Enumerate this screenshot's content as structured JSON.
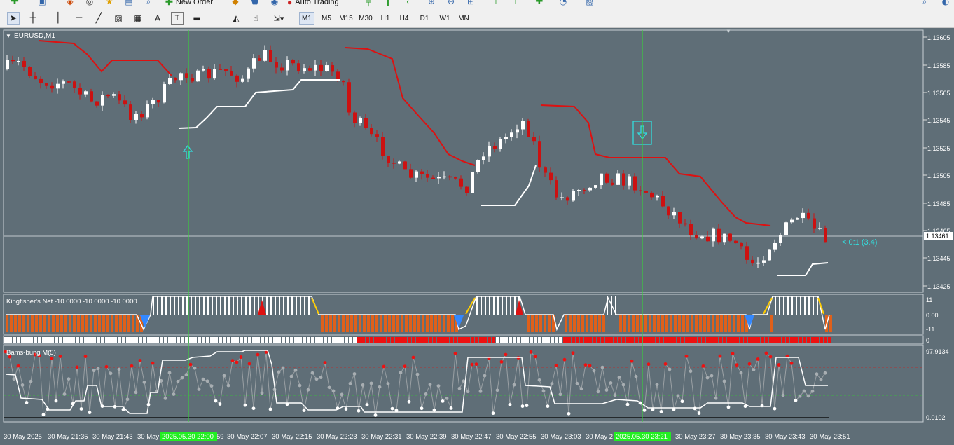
{
  "toolbar_top": {
    "new_order_label": "New Order",
    "auto_trading_label": "Auto Trading"
  },
  "toolbar_tools": {
    "timeframes": [
      "M1",
      "M5",
      "M15",
      "M30",
      "H1",
      "H4",
      "D1",
      "W1",
      "MN"
    ],
    "active_timeframe": "M1"
  },
  "chart": {
    "symbol_label": "EURUSD,M1",
    "price_labels": [
      "1.13605",
      "1.13585",
      "1.13565",
      "1.13545",
      "1.13525",
      "1.13505",
      "1.13485",
      "1.13465",
      "1.13445",
      "1.13425"
    ],
    "current_price": "1.13461",
    "trade_annotation": "< 0:1 (3.4)",
    "colors": {
      "background": "#5f6e77",
      "bull_candle": "#ffffff",
      "bear_candle": "#cc1111",
      "resistance_line": "#dd1111",
      "support_line": "#ffffff",
      "vertical_marker": "#33dd33",
      "signal_arrow": "#33dddd"
    }
  },
  "kingfisher": {
    "label": "Kingfisher's Net -10.0000 -10.0000 -10.0000",
    "scale": [
      "11",
      "0.00",
      "-11"
    ]
  },
  "trend_strip": {
    "scale": "0"
  },
  "bams": {
    "label": "Bams-bung M(5)",
    "scale_top": "97.9134",
    "scale_bottom": "0.0102"
  },
  "time_axis": {
    "labels": [
      "30 May 2025",
      "30 May 21:35",
      "30 May 21:43",
      "30 May",
      "59",
      "30 May 22:07",
      "30 May 22:15",
      "30 May 22:23",
      "30 May 22:31",
      "30 May 22:39",
      "30 May 22:47",
      "30 May 22:55",
      "30 May 23:03",
      "30 May 2",
      "30 May 23:27",
      "30 May 23:35",
      "30 May 23:43",
      "30 May 23:51"
    ],
    "highlight_1": "2025.05.30 22:00",
    "highlight_2": "2025.05.30 23:21"
  }
}
